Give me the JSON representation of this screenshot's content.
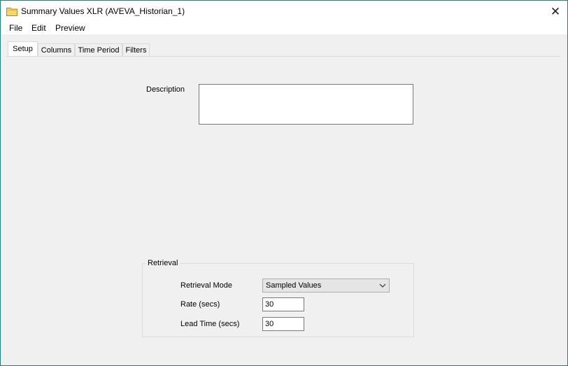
{
  "window": {
    "title": "Summary Values XLR (AVEVA_Historian_1)",
    "close_glyph": "✕"
  },
  "menu": [
    "File",
    "Edit",
    "Preview"
  ],
  "tabs": [
    "Setup",
    "Columns",
    "Time Period",
    "Filters"
  ],
  "active_tab": "Setup",
  "setup": {
    "description_label": "Description",
    "description_value": "",
    "retrieval": {
      "group_label": "Retrieval",
      "mode_label": "Retrieval Mode",
      "mode_value": "Sampled Values",
      "rate_label": "Rate (secs)",
      "rate_value": "30",
      "lead_time_label": "Lead Time (secs)",
      "lead_time_value": "30"
    }
  },
  "icons": {
    "title": "folder-icon",
    "close": "close-icon",
    "dropdown": "chevron-down-icon"
  },
  "colors": {
    "window_border": "#2b7a78",
    "folder": "#f5d76e"
  }
}
